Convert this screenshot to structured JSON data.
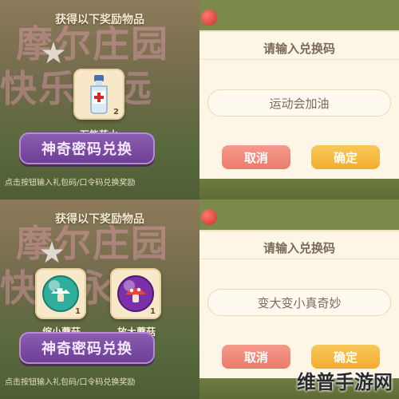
{
  "rewards_panel_1": {
    "title": "获得以下奖励物品",
    "items": [
      {
        "name": "万能药水",
        "count": "2",
        "icon": "potion-bottle-icon"
      }
    ],
    "redeem_button": "神奇密码兑换",
    "hint": "点击按钮输入礼包码/口令码兑换奖励"
  },
  "rewards_panel_2": {
    "title": "获得以下奖励物品",
    "items": [
      {
        "name": "缩小蘑菇",
        "count": "1",
        "icon": "shrink-mushroom-icon"
      },
      {
        "name": "放大蘑菇",
        "count": "1",
        "icon": "enlarge-mushroom-icon"
      }
    ],
    "redeem_button": "神奇密码兑换",
    "hint": "点击按钮输入礼包码/口令码兑换奖励"
  },
  "dialog_1": {
    "title": "请输入兑换码",
    "input_value": "运动会加油",
    "cancel": "取消",
    "confirm": "确定"
  },
  "dialog_2": {
    "title": "请输入兑换码",
    "input_value": "变大变小真奇妙",
    "cancel": "取消",
    "confirm": "确定"
  },
  "background_text": [
    "摩尔庄园",
    "快乐永远"
  ],
  "watermark": "维普手游网",
  "colors": {
    "redeem_button": "#6d3f96",
    "cancel_button": "#ea7c6c",
    "confirm_button": "#f2ad2e",
    "dialog_bg": "#fdf6e6"
  }
}
